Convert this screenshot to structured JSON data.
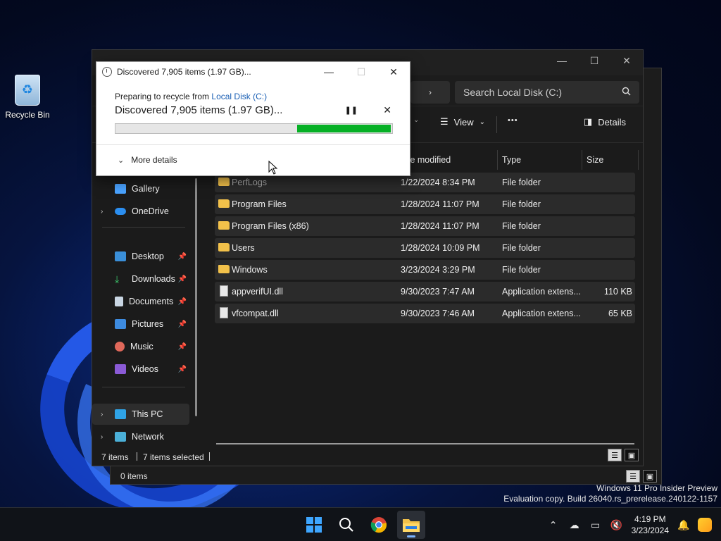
{
  "desktop": {
    "recycle_bin_label": "Recycle Bin"
  },
  "back_window": {
    "status_items": "0 items"
  },
  "explorer": {
    "search_placeholder": "Search Local Disk (C:)",
    "cmd": {
      "view_label": "View",
      "more_label": "•••",
      "details_label": "Details"
    },
    "sidebar": {
      "items": [
        {
          "label": "Gallery"
        },
        {
          "label": "OneDrive"
        },
        {
          "label": "Desktop"
        },
        {
          "label": "Downloads"
        },
        {
          "label": "Documents"
        },
        {
          "label": "Pictures"
        },
        {
          "label": "Music"
        },
        {
          "label": "Videos"
        },
        {
          "label": "This PC"
        },
        {
          "label": "Network"
        }
      ]
    },
    "columns": {
      "date": "te modified",
      "type": "Type",
      "size": "Size"
    },
    "rows": [
      {
        "name": "PerfLogs",
        "date": "1/22/2024 8:34 PM",
        "type": "File folder",
        "size": ""
      },
      {
        "name": "Program Files",
        "date": "1/28/2024 11:07 PM",
        "type": "File folder",
        "size": ""
      },
      {
        "name": "Program Files (x86)",
        "date": "1/28/2024 11:07 PM",
        "type": "File folder",
        "size": ""
      },
      {
        "name": "Users",
        "date": "1/28/2024 10:09 PM",
        "type": "File folder",
        "size": ""
      },
      {
        "name": "Windows",
        "date": "3/23/2024 3:29 PM",
        "type": "File folder",
        "size": ""
      },
      {
        "name": "appverifUI.dll",
        "date": "9/30/2023 7:47 AM",
        "type": "Application extens...",
        "size": "110 KB"
      },
      {
        "name": "vfcompat.dll",
        "date": "9/30/2023 7:46 AM",
        "type": "Application extens...",
        "size": "65 KB"
      }
    ],
    "status": {
      "count": "7 items",
      "selected": "7 items selected"
    }
  },
  "dialog": {
    "title": "Discovered 7,905 items (1.97 GB)...",
    "preparing_prefix": "Preparing to recycle from",
    "source_link": "Local Disk (C:)",
    "main_text": "Discovered 7,905 items (1.97 GB)...",
    "progress_fraction": 0.66,
    "more_details": "More details"
  },
  "watermark": {
    "line1": "Windows 11 Pro Insider Preview",
    "line2": "Evaluation copy. Build 26040.rs_prerelease.240122-1157"
  },
  "taskbar": {
    "time": "4:19 PM",
    "date": "3/23/2024"
  },
  "colors": {
    "accent_green": "#06b025",
    "link_blue": "#1a5fb4",
    "folder_yellow": "#f2c14a"
  }
}
